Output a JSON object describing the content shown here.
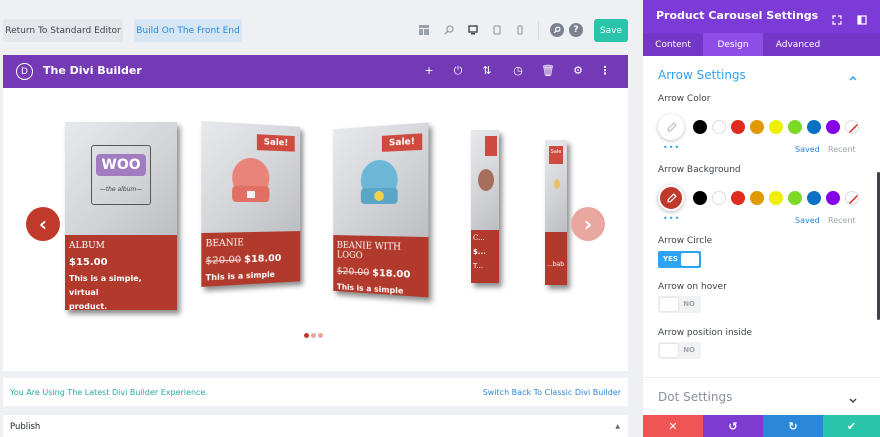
{
  "toolbar": {
    "return_label": "Return To Standard Editor",
    "frontend_label": "Build On The Front End",
    "save_label": "Save"
  },
  "builder": {
    "logo_letter": "D",
    "title": "The Divi Builder"
  },
  "carousel": {
    "products": [
      {
        "title": "ALBUM",
        "price": "$15.00",
        "old_price": "",
        "desc_line1": "This is a simple, virtual",
        "desc_line2": "product.",
        "sale": "",
        "logo_text": "WOO",
        "logo_sub": "—the album—"
      },
      {
        "title": "BEANIE",
        "price": "$18.00",
        "old_price": "$20.00",
        "desc_line1": "This is a simple product.",
        "desc_line2": "",
        "sale": "Sale!",
        "badge": "",
        "logo_text": ""
      },
      {
        "title": "BEANIE WITH LOGO",
        "price": "$18.00",
        "old_price": "$20.00",
        "desc_line1": "This is a simple product.",
        "desc_line2": "",
        "sale": "Sale!",
        "badge": "☺",
        "logo_text": ""
      },
      {
        "title": "C...",
        "price": "$...",
        "old_price": "",
        "desc_line1": "T...",
        "desc_line2": "",
        "sale": "",
        "logo_text": ""
      },
      {
        "title": "",
        "price": "",
        "old_price": "",
        "desc_line1": "...bab",
        "desc_line2": "",
        "sale": "Sale",
        "logo_text": ""
      }
    ],
    "active_dot": 0,
    "dots_count": 3,
    "colors": {
      "card_footer": "#b13a2c",
      "arrow_left": "#c0392b",
      "arrow_right": "#e8a89f"
    }
  },
  "info": {
    "left_text": "You Are Using The Latest Divi Builder Experience.",
    "right_text": "Switch Back To Classic Divi Builder"
  },
  "publish": {
    "label": "Publish",
    "caret": "▲"
  },
  "panel": {
    "title": "Product Carousel Settings",
    "tabs": [
      {
        "label": "Content",
        "active": false
      },
      {
        "label": "Design",
        "active": true
      },
      {
        "label": "Advanced",
        "active": false
      }
    ],
    "arrow_section_title": "Arrow Settings",
    "arrow_color_label": "Arrow Color",
    "arrow_bg_label": "Arrow Background",
    "saved_label": "Saved",
    "recent_label": "Recent",
    "dots_label": "•••",
    "arrow_circle_label": "Arrow Circle",
    "arrow_circle_toggle": "YES",
    "arrow_hover_label": "Arrow on hover",
    "arrow_hover_toggle": "NO",
    "arrow_inside_label": "Arrow position inside",
    "arrow_inside_toggle": "NO",
    "dot_section_title": "Dot Settings",
    "swatches": [
      "#000000",
      "#ffffff",
      "#e02b20",
      "#e09900",
      "#edf000",
      "#7cda24",
      "#0c71c3",
      "#8300e9"
    ],
    "colors": {
      "accent": "#2ea3f2",
      "purple": "#7c3bd6",
      "bg_active": "#c0392b"
    }
  },
  "footer": {
    "cancel_icon": "✕",
    "undo_icon": "↺",
    "redo_icon": "↻",
    "ok_icon": "✔",
    "colors": {
      "cancel": "#ef5555",
      "undo": "#7e3bd0",
      "redo": "#2b87da",
      "ok": "#29c4a9"
    }
  }
}
